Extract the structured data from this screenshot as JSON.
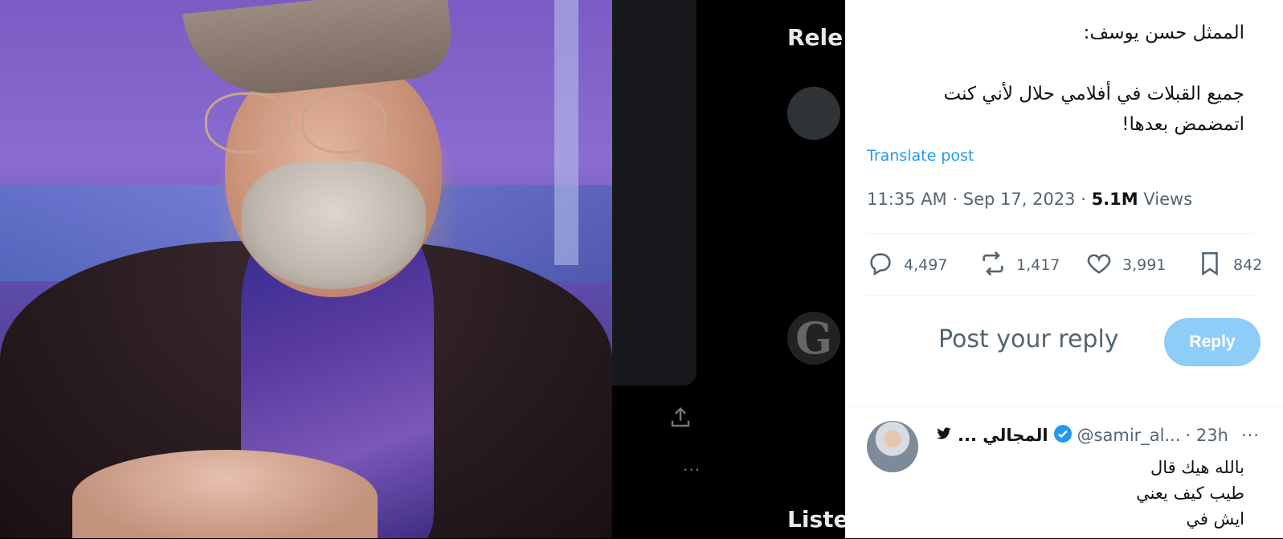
{
  "media": {
    "alt": ""
  },
  "middle": {
    "heading_top": "Rele",
    "heading_bottom": "Liste",
    "avatar_letter": "G"
  },
  "tweet": {
    "text_line1": "الممثل حسن يوسف:",
    "text_line2": "جميع القبلات في أفلامي حلال لأني كنت",
    "text_line3": "اتمضمض بعدها!",
    "translate_label": "Translate post",
    "time": "11:35 AM",
    "date": "Sep 17, 2023",
    "views_count": "5.1M",
    "views_label": "Views",
    "separator": "·"
  },
  "actions": {
    "replies": "4,497",
    "reposts": "1,417",
    "likes": "3,991",
    "bookmarks": "842"
  },
  "composer": {
    "placeholder": "Post your reply",
    "reply_button": "Reply"
  },
  "reply": {
    "name": "المجالي ...",
    "handle": "@samir_al...",
    "time": "· 23h",
    "more": "···",
    "line1": "بالله هيك قال",
    "line2": "طيب كيف يعني",
    "line3": "ايش في"
  },
  "colors": {
    "accent": "#1d9bf0",
    "reply_button_disabled": "#8ecdf7",
    "muted_text": "#536471",
    "primary_text": "#0f1419"
  }
}
